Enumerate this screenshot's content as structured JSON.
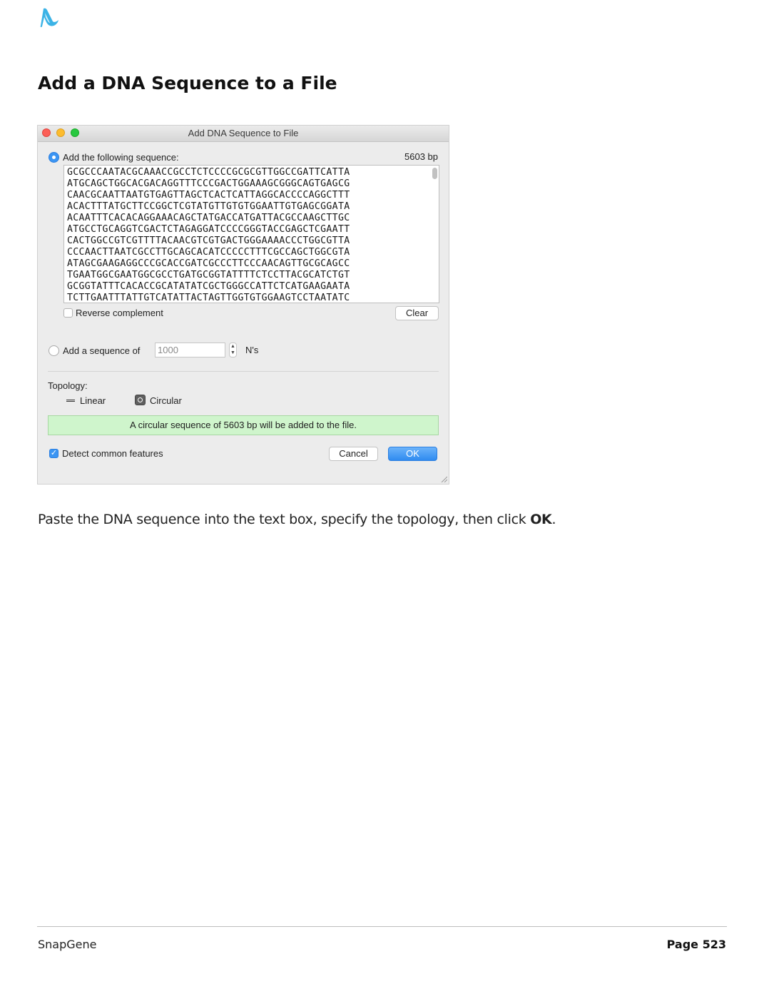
{
  "page": {
    "title": "Add a DNA Sequence to a File",
    "instruction_before": "Paste the DNA sequence into the text box, specify the topology, then click ",
    "instruction_emphasis": "OK",
    "instruction_after": ".",
    "footer_left": "SnapGene",
    "footer_right": "Page 523",
    "brand_color": "#3bb3e6"
  },
  "dialog": {
    "title": "Add DNA Sequence to File",
    "add_sequence_label": "Add the following sequence:",
    "add_sequence_selected": true,
    "length_label": "5603 bp",
    "sequence_lines": [
      "GCGCCCAATACGCAAACCGCCTCTCCCCGCGCGTTGGCCGATTCATTA",
      "ATGCAGCTGGCACGACAGGTTTCCCGACTGGAAAGCGGGCAGTGAGCG",
      "CAACGCAATTAATGTGAGTTAGCTCACTCATTAGGCACCCCAGGCTTT",
      "ACACTTTATGCTTCCGGCTCGTATGTTGTGTGGAATTGTGAGCGGATA",
      "ACAATTTCACACAGGAAACAGCTATGACCATGATTACGCCAAGCTTGC",
      "ATGCCTGCAGGTCGACTCTAGAGGATCCCCGGGTACCGAGCTCGAATT",
      "CACTGGCCGTCGTTTTACAACGTCGTGACTGGGAAAACCCTGGCGTTA",
      "CCCAACTTAATCGCCTTGCAGCACATCCCCCTTTCGCCAGCTGGCGTA",
      "ATAGCGAAGAGGCCCGCACCGATCGCCCTTCCCAACAGTTGCGCAGCC",
      "TGAATGGCGAATGGCGCCTGATGCGGTATTTTCTCCTTACGCATCTGT",
      "GCGGTATTTCACACCGCATATATCGCTGGGCCATTCTCATGAAGAATA",
      "TCTTGAATTTATTGTCATATTACTAGTTGGTGTGGAAGTCCTAATATC"
    ],
    "reverse_complement_label": "Reverse complement",
    "reverse_complement_checked": false,
    "clear_label": "Clear",
    "add_n_label": "Add a sequence of",
    "n_value": "1000",
    "n_suffix": "N's",
    "topology_label": "Topology:",
    "linear_label": "Linear",
    "circular_label": "Circular",
    "topology_selected": "Circular",
    "status_message": "A circular sequence of 5603 bp will be added to the file.",
    "detect_features_label": "Detect common features",
    "detect_features_checked": true,
    "cancel_label": "Cancel",
    "ok_label": "OK"
  }
}
